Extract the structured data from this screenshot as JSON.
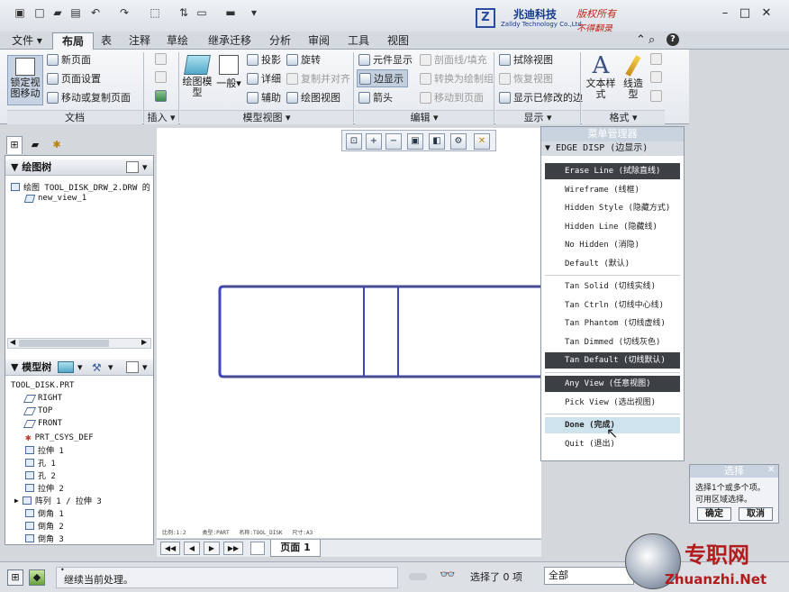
{
  "titlebar": {
    "logo_mark": "Z",
    "company_cn": "兆迪科技",
    "company_en": "Zalldy Technology Co.,Ltd.",
    "notice1": "版权所有",
    "notice2": "不得翻录"
  },
  "tabs": [
    "文件",
    "布局",
    "表",
    "注释",
    "草绘",
    "继承迁移",
    "分析",
    "审阅",
    "工具",
    "视图"
  ],
  "active_tab": "布局",
  "ribbon": {
    "doc": {
      "lock": "锁定视图移动",
      "new_page": "新页面",
      "page_setup": "页面设置",
      "move_copy": "移动或复制页面",
      "label": "文档"
    },
    "insert": {
      "label": "插入"
    },
    "model_views": {
      "drawing_model": "绘图模型",
      "general": "一般",
      "projection": "投影",
      "detail": "详细",
      "auxiliary": "辅助",
      "revolve": "旋转",
      "copy_align": "复制并对齐",
      "drawing_view": "绘图视图",
      "label": "模型视图"
    },
    "edit": {
      "element_display": "元件显示",
      "edge_display": "边显示",
      "arrow": "箭头",
      "section_line": "剖面线/填充",
      "convert": "转换为绘制组",
      "move_to_page": "移动到页面",
      "label": "编辑"
    },
    "display": {
      "erase_view": "拭除视图",
      "restore_view": "恢复视图",
      "show_modified": "显示已修改的边",
      "label": "显示"
    },
    "format": {
      "text_style": "文本样式",
      "line_style": "线造型",
      "label": "格式"
    }
  },
  "left_pane": {
    "drawing_tree_title": "绘图树",
    "drawing_root": "绘图 TOOL_DISK_DRW_2.DRW 的",
    "drawing_child": "new_view_1",
    "model_tree_title": "模型树",
    "model_items": [
      "TOOL_DISK.PRT",
      "RIGHT",
      "TOP",
      "FRONT",
      "PRT_CSYS_DEF",
      "拉伸 1",
      "孔 1",
      "孔 2",
      "拉伸 2",
      "阵列 1 / 拉伸 3",
      "倒角 1",
      "倒角 2",
      "倒角 3"
    ]
  },
  "menu_manager": {
    "title": "菜单管理器",
    "section": "EDGE DISP (边显示)",
    "items": [
      {
        "label": "Erase Line (拭除直线)",
        "style": "dark"
      },
      {
        "label": "Wireframe (线框)",
        "style": "normal"
      },
      {
        "label": "Hidden Style (隐藏方式)",
        "style": "normal"
      },
      {
        "label": "Hidden Line (隐藏线)",
        "style": "normal"
      },
      {
        "label": "No Hidden (消隐)",
        "style": "normal"
      },
      {
        "label": "Default (默认)",
        "style": "normal"
      },
      {
        "label": "Tan Solid (切线实线)",
        "style": "normal"
      },
      {
        "label": "Tan Ctrln (切线中心线)",
        "style": "normal"
      },
      {
        "label": "Tan Phantom (切线虚线)",
        "style": "normal"
      },
      {
        "label": "Tan Dimmed (切线灰色)",
        "style": "normal"
      },
      {
        "label": "Tan Default (切线默认)",
        "style": "dark"
      },
      {
        "label": "Any View (任意视图)",
        "style": "dark"
      },
      {
        "label": "Pick View (选出视图)",
        "style": "normal"
      },
      {
        "label": "Done (完成)",
        "style": "highlight"
      },
      {
        "label": "Quit (退出)",
        "style": "normal"
      }
    ]
  },
  "select_dialog": {
    "title": "选择",
    "line1": "选择1个或多个项。",
    "line2": "可用区域选择。",
    "ok": "确定",
    "cancel": "取消"
  },
  "canvas_footer": {
    "scale": "比例:1:2",
    "type": "类型:PART",
    "name": "名称:TOOL_DISK",
    "size": "尺寸:A3",
    "page": "页面 1"
  },
  "status": {
    "message": "继续当前处理。",
    "selected": "选择了 0 项",
    "filter": "全部"
  },
  "watermark": {
    "cn": "专职网",
    "en": "Zhuanzhi.Net"
  },
  "colors": {
    "accent": "#143a8c",
    "outline": "#3f46b8",
    "menu_dark": "#3c3f44",
    "menu_hl": "#cfe3ee",
    "watermark": "#b21c1c"
  }
}
